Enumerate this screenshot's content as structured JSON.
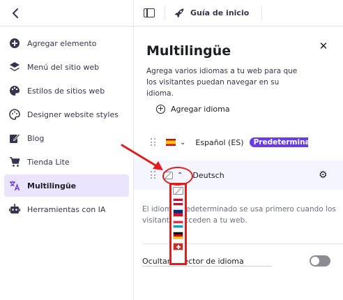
{
  "sidebar": {
    "items": [
      {
        "label": "Agregar elemento",
        "icon": "plus-circle-icon"
      },
      {
        "label": "Menú del sitio web",
        "icon": "layers-icon"
      },
      {
        "label": "Estilos de sitios web",
        "icon": "palette-icon"
      },
      {
        "label": "Designer website styles",
        "icon": "palette-icon"
      },
      {
        "label": "Blog",
        "icon": "edit-icon"
      },
      {
        "label": "Tienda Lite",
        "icon": "cart-icon"
      },
      {
        "label": "Multilingüe",
        "icon": "translate-icon",
        "active": true
      },
      {
        "label": "Herramientas con IA",
        "icon": "robot-icon"
      }
    ]
  },
  "topbar": {
    "guide_label": "Guía de inicio"
  },
  "panel": {
    "title": "Multilingüe",
    "description": "Agrega varios idiomas a tu web para que los visitantes puedan navegar en su idioma.",
    "add_language": "Agregar idioma",
    "languages": [
      {
        "name": "Español (ES)",
        "badge": "Predetermina"
      },
      {
        "name": "Deutsch"
      }
    ],
    "info": "El idioma predeterminado se usa primero cuando los visitantes acceden a tu web.",
    "hide_selector_label": "Ocultar selector de idioma",
    "hide_selector_on": false
  },
  "flag_options": [
    "none",
    "Austria",
    "Liechtenstein",
    "Luxembourg",
    "Germany",
    "Switzerland"
  ],
  "colors": {
    "accent": "#673de6",
    "active_bg": "#ebe4ff",
    "annotation": "#e11d1d"
  }
}
